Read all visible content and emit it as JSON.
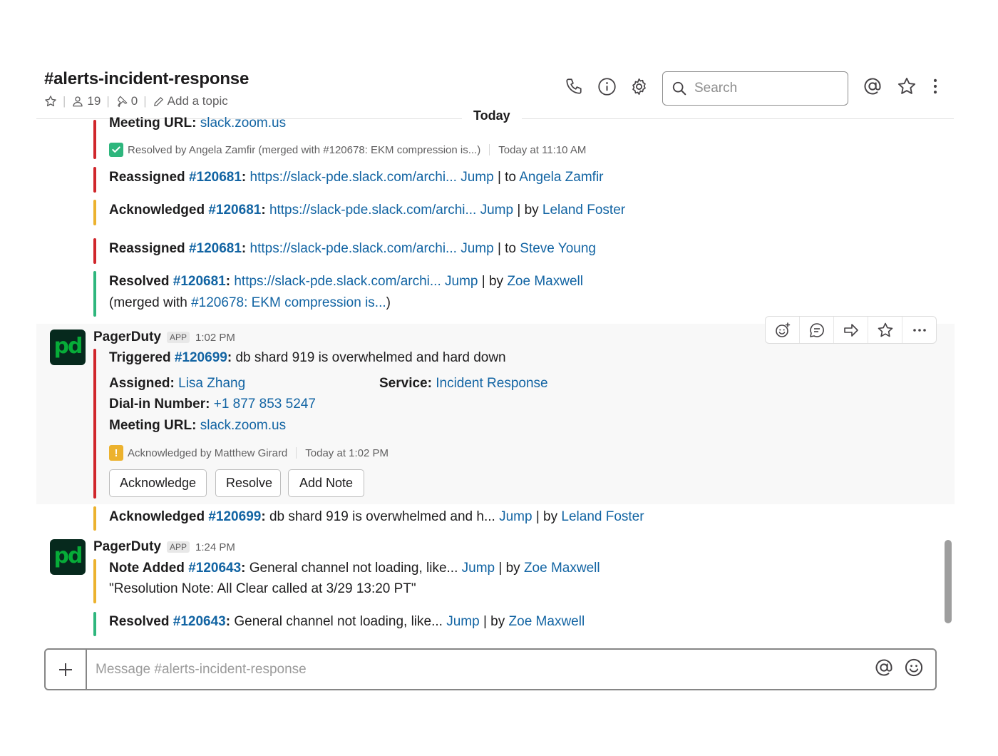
{
  "header": {
    "channel_name": "#alerts-incident-response",
    "member_count": "19",
    "pinned_count": "0",
    "add_topic": "Add a topic",
    "search_placeholder": "Search"
  },
  "divider_label": "Today",
  "messages": [
    {
      "meeting_label": "Meeting URL:",
      "meeting_link": "slack.zoom.us",
      "status_text": "Resolved by Angela Zamfir (merged with #120678: EKM compression is...)",
      "status_time": "Today at 11:10 AM"
    },
    {
      "action": "Reassigned",
      "incident": "#120681",
      "link": "https://slack-pde.slack.com/archi...",
      "jump": "Jump",
      "preposition": "| to",
      "person": "Angela Zamfir"
    },
    {
      "action": "Acknowledged",
      "incident": "#120681",
      "link": "https://slack-pde.slack.com/archi...",
      "jump": "Jump",
      "preposition": "| by",
      "person": "Leland Foster"
    },
    {
      "action": "Reassigned",
      "incident": "#120681",
      "link": "https://slack-pde.slack.com/archi...",
      "jump": "Jump",
      "preposition": "| to",
      "person": "Steve Young"
    },
    {
      "action": "Resolved",
      "incident": "#120681",
      "link": "https://slack-pde.slack.com/archi...",
      "jump": "Jump",
      "preposition": "| by",
      "person": "Zoe Maxwell",
      "merged_prefix": "(merged with",
      "merged_link": "#120678: EKM compression is...",
      "merged_suffix": ")"
    }
  ],
  "pd_message_1": {
    "sender": "PagerDuty",
    "badge": "APP",
    "time": "1:02 PM",
    "action": "Triggered",
    "incident": "#120699",
    "summary": "db shard 919 is overwhelmed and hard down",
    "assigned_label": "Assigned:",
    "assigned_value": "Lisa Zhang",
    "service_label": "Service:",
    "service_value": "Incident Response",
    "dial_label": "Dial-in Number:",
    "dial_value": "+1 877 853 5247",
    "meeting_label": "Meeting URL:",
    "meeting_value": "slack.zoom.us",
    "status_text": "Acknowledged by Matthew Girard",
    "status_time": "Today at 1:02 PM",
    "buttons": [
      "Acknowledge",
      "Resolve",
      "Add Note"
    ]
  },
  "ack_line": {
    "action": "Acknowledged",
    "incident": "#120699",
    "summary": "db shard 919 is overwhelmed and h...",
    "jump": "Jump",
    "preposition": "| by",
    "person": "Leland Foster"
  },
  "pd_message_2": {
    "sender": "PagerDuty",
    "badge": "APP",
    "time": "1:24 PM",
    "note": {
      "action": "Note Added",
      "incident": "#120643",
      "summary": "General channel not loading, like...",
      "jump": "Jump",
      "preposition": "| by",
      "person": "Zoe Maxwell",
      "quote": "\"Resolution Note: All Clear called at 3/29 13:20 PT\""
    },
    "resolved": {
      "action": "Resolved",
      "incident": "#120643",
      "summary": "General channel not loading, like...",
      "jump": "Jump",
      "preposition": "| by",
      "person": "Zoe Maxwell"
    }
  },
  "composer": {
    "placeholder": "Message #alerts-incident-response"
  },
  "avatar_text": "pd",
  "colors": {
    "link": "#1264a3",
    "red": "#d0262b",
    "yellow": "#ecb22e",
    "green": "#2eb67d",
    "pd_bg": "#06291d",
    "pd_text": "#06ac38"
  },
  "icons": [
    "star-outline-icon",
    "person-icon",
    "pin-icon",
    "pencil-icon",
    "phone-icon",
    "info-icon",
    "gear-icon",
    "search-icon",
    "at-sign-icon",
    "star-icon",
    "more-vertical-icon",
    "add-reaction-icon",
    "reply-thread-icon",
    "share-icon",
    "star-icon",
    "more-horizontal-icon",
    "check-icon",
    "warning-icon",
    "plus-icon",
    "at-sign-icon",
    "emoji-icon"
  ]
}
